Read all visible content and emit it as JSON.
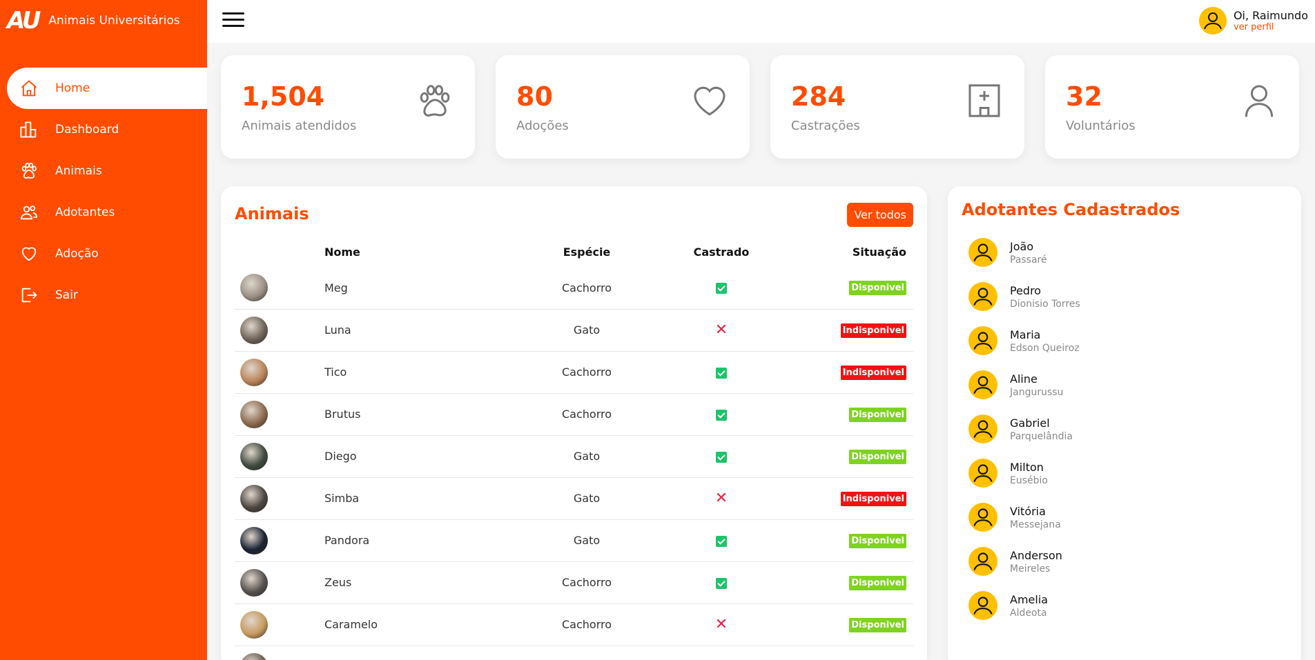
{
  "brand": {
    "logo": "AU",
    "title": "Animais Universitários"
  },
  "menu": [
    {
      "label": "Home",
      "icon": "home-icon",
      "active": true
    },
    {
      "label": "Dashboard",
      "icon": "chart-bars-icon"
    },
    {
      "label": "Animais",
      "icon": "paw-icon"
    },
    {
      "label": "Adotantes",
      "icon": "people-icon"
    },
    {
      "label": "Adoção",
      "icon": "heart-icon"
    },
    {
      "label": "Sair",
      "icon": "logout-icon"
    }
  ],
  "user": {
    "greeting": "Oi, Raimundo",
    "profile_link": "ver perfil"
  },
  "stats": [
    {
      "value": "1,504",
      "label": "Animais atendidos",
      "icon": "paw-icon"
    },
    {
      "value": "80",
      "label": "Adoções",
      "icon": "heart-icon"
    },
    {
      "value": "284",
      "label": "Castrações",
      "icon": "hospital-icon"
    },
    {
      "value": "32",
      "label": "Voluntários",
      "icon": "person-icon"
    }
  ],
  "animals": {
    "title": "Animais",
    "button": "Ver todos",
    "columns": {
      "name": "Nome",
      "species": "Espécie",
      "neutered": "Castrado",
      "status": "Situação"
    },
    "rows": [
      {
        "name": "Meg",
        "species": "Cachorro",
        "neutered": true,
        "status": "Disponivel",
        "color": "#9a8f85"
      },
      {
        "name": "Luna",
        "species": "Gato",
        "neutered": false,
        "status": "Indisponivel",
        "color": "#6e6358"
      },
      {
        "name": "Tico",
        "species": "Cachorro",
        "neutered": true,
        "status": "Indisponivel",
        "color": "#b98459"
      },
      {
        "name": "Brutus",
        "species": "Cachorro",
        "neutered": true,
        "status": "Disponivel",
        "color": "#8c6a4e"
      },
      {
        "name": "Diego",
        "species": "Gato",
        "neutered": true,
        "status": "Disponivel",
        "color": "#3f4a3e"
      },
      {
        "name": "Simba",
        "species": "Gato",
        "neutered": false,
        "status": "Indisponivel",
        "color": "#4b4540"
      },
      {
        "name": "Pandora",
        "species": "Gato",
        "neutered": true,
        "status": "Disponivel",
        "color": "#1a2233"
      },
      {
        "name": "Zeus",
        "species": "Cachorro",
        "neutered": true,
        "status": "Disponivel",
        "color": "#55514f"
      },
      {
        "name": "Caramelo",
        "species": "Cachorro",
        "neutered": false,
        "status": "Disponivel",
        "color": "#c79a5e"
      },
      {
        "name": "",
        "species": "",
        "neutered": true,
        "status": "",
        "color": "#6a5e52"
      }
    ]
  },
  "adopters": {
    "title": "Adotantes Cadastrados",
    "list": [
      {
        "name": "João",
        "place": "Passaré"
      },
      {
        "name": "Pedro",
        "place": "Dionisio Torres"
      },
      {
        "name": "Maria",
        "place": "Edson Queiroz"
      },
      {
        "name": "Aline",
        "place": "Jangurussu"
      },
      {
        "name": "Gabriel",
        "place": "Parquelândia"
      },
      {
        "name": "Milton",
        "place": "Eusébio"
      },
      {
        "name": "Vitória",
        "place": "Messejana"
      },
      {
        "name": "Anderson",
        "place": "Meireles"
      },
      {
        "name": "Amelia",
        "place": "Aldeota"
      }
    ]
  },
  "colors": {
    "accent": "#ff4c00",
    "available": "#7ed321",
    "unavailable": "#f21212",
    "check": "#1cc46b",
    "avatar": "#ffc000"
  }
}
